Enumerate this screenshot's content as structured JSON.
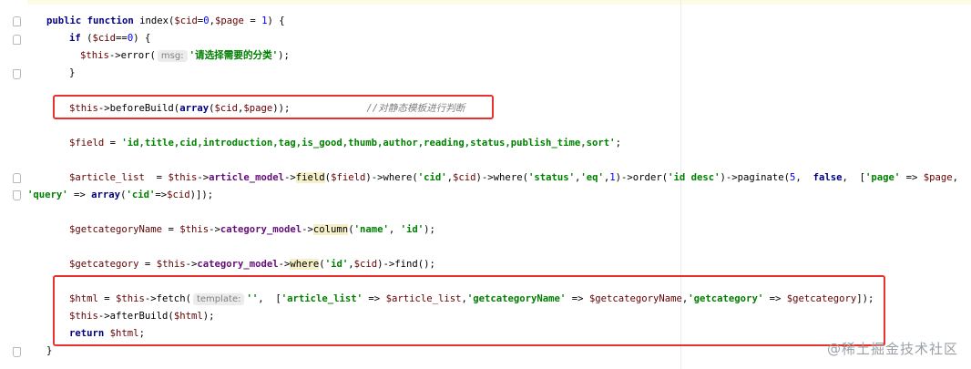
{
  "editor": {
    "lines": {
      "l1": {
        "kw1": "public",
        "kw2": "function",
        "name": " index(",
        "v1": "$cid",
        "eq1": "=",
        "n1": "0",
        ",": ",",
        "v2": "$page",
        "eq2": " = ",
        "n2": "1",
        ") {": ") {"
      },
      "l2": {
        "kw": "if",
        "open": " (",
        "v": "$cid",
        "op": "==",
        "n": "0",
        ") {": ") {"
      },
      "l3": {
        "v": "$this",
        "call": "->error(",
        "hint": "msg:",
        "str": "'请选择需要的分类'",
        "end": ");"
      },
      "l4": {
        "brace": "}"
      },
      "l5": {
        "v": "$this",
        "call": "->beforeBuild(",
        "kw": "array",
        "open": "(",
        "a1": "$cid",
        ",": ",",
        "a2": "$page",
        "end": "));",
        "cmt": "//对静态模板进行判断"
      },
      "l6": {
        "v": "$field",
        "eq": " = ",
        "str": "'id,title,cid,introduction,tag,is_good,thumb,author,reading,status,publish_time,sort'",
        "end": ";"
      },
      "l7": {
        "v": "$article_list",
        "eq": "  = ",
        "v2": "$this",
        "a1": "->",
        "f1": "article_model",
        "a2": "->",
        "m1": "field",
        "p1": "(",
        "v3": "$field",
        "p2": ")->where(",
        "s1": "'cid'",
        "c1": ",",
        "v4": "$cid",
        "p3": ")->where(",
        "s2": "'status'",
        "c2": ",",
        "s3": "'eq'",
        "c3": ",",
        "n1": "1",
        "p4": ")->order(",
        "s4": "'id desc'",
        "p5": ")->paginate(",
        "n2": "5",
        "c4": ",  ",
        "kw": "false",
        "c5": ",  [",
        "s5": "'page'",
        "ar": " => ",
        "v5": "$page",
        ",": ","
      },
      "l8": {
        "s1": "'query'",
        "ar": " => ",
        "kw": "array",
        "p1": "(",
        "s2": "'cid'",
        "ar2": "=>",
        "v": "$cid",
        "end": ")]);"
      },
      "l9": {
        "v": "$getcategoryName",
        "eq": " = ",
        "v2": "$this",
        "a1": "->",
        "f": "category_model",
        "a2": "->",
        "m": "column",
        "p1": "(",
        "s1": "'name'",
        "c": ", ",
        "s2": "'id'",
        "end": ");"
      },
      "l10": {
        "v": "$getcategory",
        "eq": " = ",
        "v2": "$this",
        "a1": "->",
        "f": "category_model",
        "a2": "->",
        "m": "where",
        "p1": "(",
        "s1": "'id'",
        "c": ",",
        "v3": "$cid",
        "end": ")->find();"
      },
      "l11": {
        "v": "$html",
        "eq": " = ",
        "v2": "$this",
        "call": "->fetch(",
        "hint": "template:",
        "s0": "''",
        "c0": ",  [",
        "s1": "'article_list'",
        "ar1": " => ",
        "v3": "$article_list",
        "c1": ",",
        "s2": "'getcategoryName'",
        "ar2": " => ",
        "v4": "$getcategoryName",
        "c2": ",",
        "s3": "'getcategory'",
        "ar3": " => ",
        "v5": "$getcategory",
        "end": "]);"
      },
      "l12": {
        "v": "$this",
        "call": "->afterBuild(",
        "v2": "$html",
        "end": ");"
      },
      "l13": {
        "kw": "return",
        "sp": " ",
        "v": "$html",
        "end": ";"
      },
      "l14": {
        "brace": "}"
      }
    }
  },
  "watermark": "@稀土掘金技术社区",
  "colors": {
    "keyword": "#000080",
    "variable": "#660000",
    "string": "#008000",
    "number": "#0000ff",
    "field": "#660e7a",
    "comment": "#808080",
    "highlight_box": "#e8302e"
  }
}
